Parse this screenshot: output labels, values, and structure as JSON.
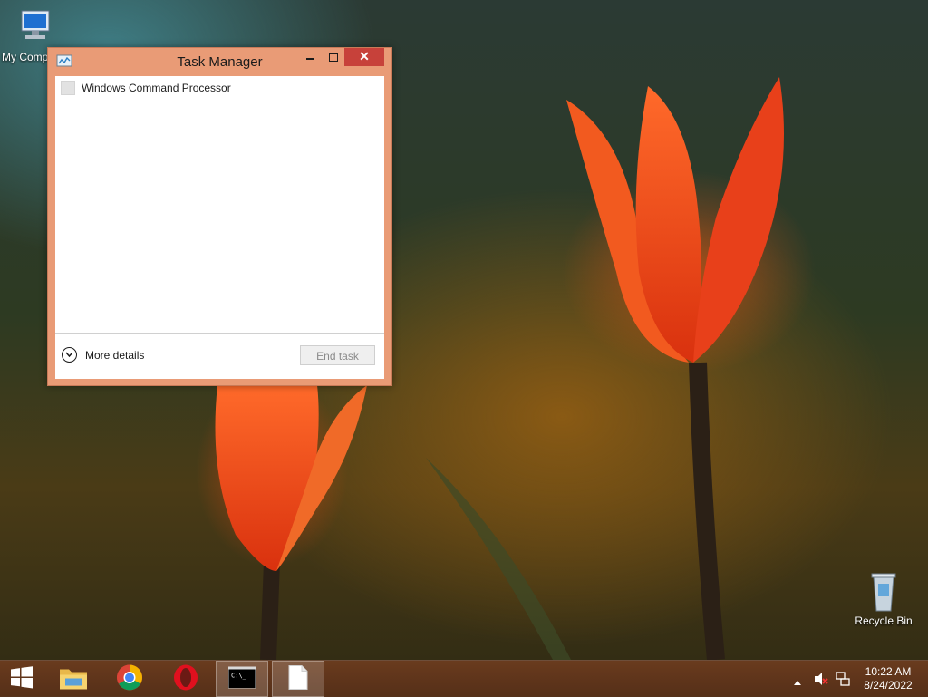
{
  "desktop": {
    "icons": [
      {
        "label": "My Comp",
        "icon": "computer-icon"
      },
      {
        "label": "Recycle Bin",
        "icon": "recycle-bin-icon"
      }
    ]
  },
  "task_manager": {
    "title": "Task Manager",
    "processes": [
      {
        "name": "Windows Command Processor",
        "icon": "cmd-icon"
      }
    ],
    "more_details_label": "More details",
    "end_task_label": "End task"
  },
  "taskbar": {
    "items": [
      {
        "name": "start",
        "icon": "windows-logo-icon"
      },
      {
        "name": "file-explorer",
        "icon": "folder-icon"
      },
      {
        "name": "chrome",
        "icon": "chrome-icon"
      },
      {
        "name": "opera",
        "icon": "opera-icon"
      },
      {
        "name": "command-prompt",
        "icon": "cmd-icon"
      },
      {
        "name": "task-manager",
        "icon": "document-icon"
      }
    ],
    "tray": {
      "time": "10:22 AM",
      "date": "8/24/2022"
    }
  },
  "colors": {
    "window_frame": "#e99b76",
    "close_button": "#c7413a",
    "taskbar": "#6e3c1e"
  }
}
